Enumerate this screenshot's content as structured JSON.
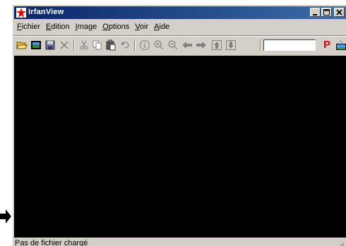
{
  "window": {
    "title": "IrfanView",
    "controls": {
      "minimize": "minimize",
      "maximize": "maximize",
      "close": "close"
    }
  },
  "menu": {
    "items": [
      {
        "label": "Fichier",
        "accel": "F",
        "rest": "ichier"
      },
      {
        "label": "Edition",
        "accel": "E",
        "rest": "dition"
      },
      {
        "label": "Image",
        "accel": "I",
        "rest": "mage"
      },
      {
        "label": "Options",
        "accel": "O",
        "rest": "ptions"
      },
      {
        "label": "Voir",
        "accel": "V",
        "rest": "oir"
      },
      {
        "label": "Aide",
        "accel": "A",
        "rest": "ide"
      }
    ]
  },
  "toolbar": {
    "zoom_value": "",
    "paint_label": "P",
    "icons": [
      "open-folder-icon",
      "slideshow-icon",
      "save-icon",
      "delete-icon",
      "cut-icon",
      "copy-icon",
      "paste-icon",
      "undo-icon",
      "info-icon",
      "zoom-in-icon",
      "zoom-out-icon",
      "previous-icon",
      "next-icon",
      "first-icon",
      "last-icon",
      "paint-icon",
      "thumbnails-icon"
    ]
  },
  "status": {
    "text": "Pas de fichier chargé"
  },
  "colors": {
    "titlebar_start": "#0a246a",
    "titlebar_end": "#3a6ea5",
    "canvas": "#000000",
    "chrome": "#d4d0c8",
    "paint_red": "#e00000"
  }
}
